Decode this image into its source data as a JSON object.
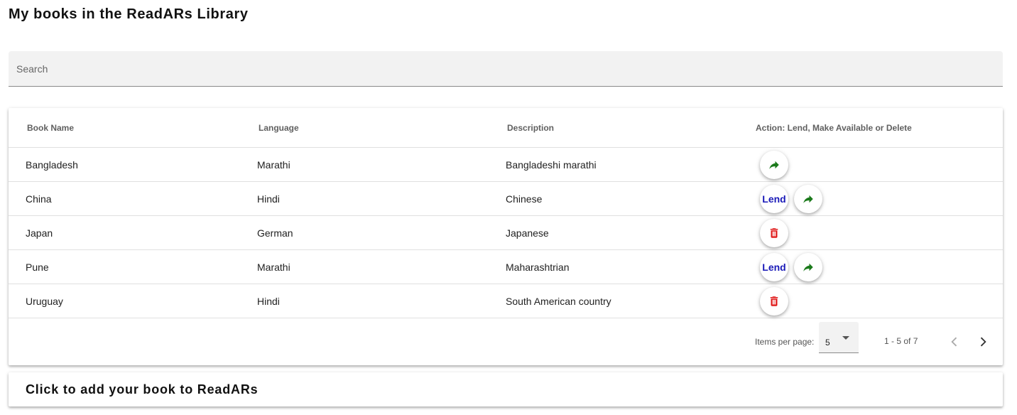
{
  "page": {
    "title": "My books in the ReadARs Library"
  },
  "search": {
    "placeholder": "Search"
  },
  "table": {
    "columns": [
      "Book Name",
      "Language",
      "Description",
      "Action: Lend, Make Available or Delete"
    ],
    "rows": [
      {
        "book_name": "Bangladesh",
        "language": "Marathi",
        "description": "Bangladeshi marathi",
        "actions": [
          "share-icon"
        ]
      },
      {
        "book_name": "China",
        "language": "Hindi",
        "description": "Chinese",
        "actions": [
          "Lend",
          "share-icon"
        ]
      },
      {
        "book_name": "Japan",
        "language": "German",
        "description": "Japanese",
        "actions": [
          "trash-icon"
        ]
      },
      {
        "book_name": "Pune",
        "language": "Marathi",
        "description": "Maharashtrian",
        "actions": [
          "Lend",
          "share-icon"
        ]
      },
      {
        "book_name": "Uruguay",
        "language": "Hindi",
        "description": "South American country",
        "actions": [
          "trash-icon"
        ]
      }
    ]
  },
  "actions": {
    "lend_label": "Lend"
  },
  "paginator": {
    "items_per_page_label": "Items per page:",
    "items_per_page_value": "5",
    "range_label": "1 - 5 of 7"
  },
  "add_book": {
    "label": "Click to add your book to ReadARs"
  },
  "colors": {
    "share_icon": "#1b7a1b",
    "trash_icon": "#e01b1b",
    "lend_text": "#1a1ab8"
  }
}
